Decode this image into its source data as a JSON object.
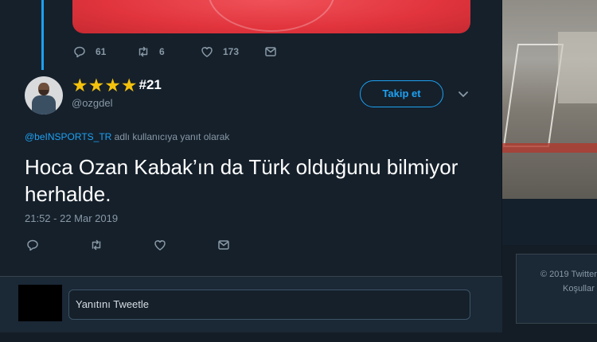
{
  "prev_tweet": {
    "actions": [
      {
        "icon": "reply-icon",
        "count": "61"
      },
      {
        "icon": "retweet-icon",
        "count": "6"
      },
      {
        "icon": "heart-icon",
        "count": "173"
      },
      {
        "icon": "dm-icon",
        "count": ""
      }
    ]
  },
  "tweet": {
    "author_stars": "★★★★",
    "author_number": "#21",
    "handle": "@ozgdel",
    "follow_label": "Takip et",
    "reply_mention": "@beINSPORTS_TR",
    "reply_suffix": " adlı kullanıcıya yanıt olarak",
    "text": "Hoca Ozan Kabak’ın da Türk olduğunu bilmiyor herhalde.",
    "timestamp": "21:52 - 22 Mar 2019"
  },
  "reply_box": {
    "placeholder": "Yanıtını Tweetle"
  },
  "footer": {
    "line1": "© 2019 Twitter",
    "line2": "Koşullar"
  },
  "colors": {
    "accent": "#1da1f2",
    "background": "#15202b",
    "secondary_text": "#8899a6",
    "star": "#f4c20d"
  }
}
